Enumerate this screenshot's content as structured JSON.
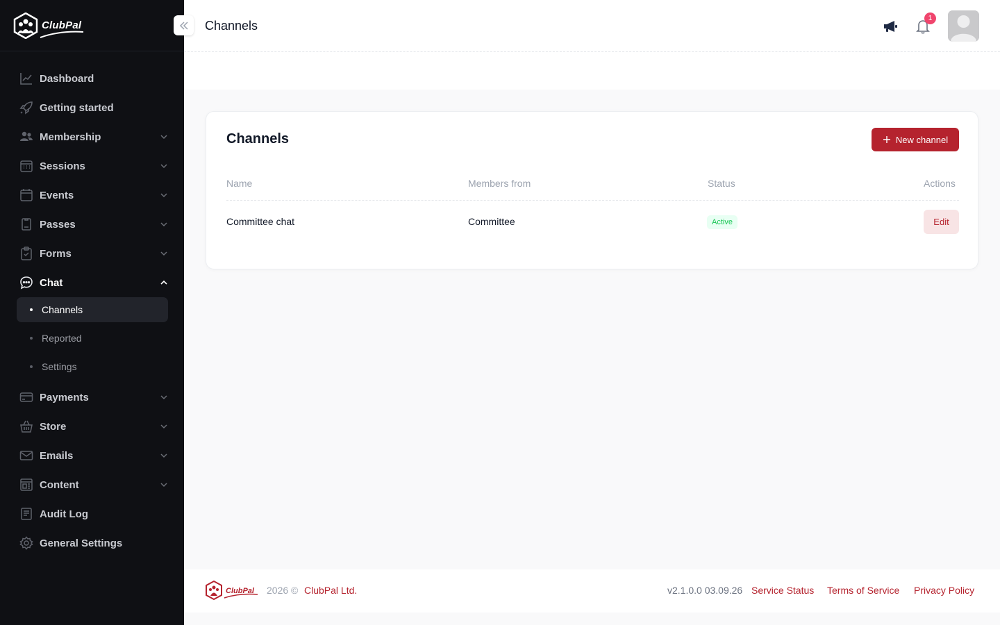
{
  "app": {
    "brand": "ClubPal",
    "accent": "#b5232e"
  },
  "header": {
    "title": "Channels",
    "notification_count": "1"
  },
  "sidebar": {
    "items": [
      {
        "label": "Dashboard",
        "icon": "chart-line-icon"
      },
      {
        "label": "Getting started",
        "icon": "rocket-icon"
      },
      {
        "label": "Membership",
        "icon": "users-icon"
      },
      {
        "label": "Sessions",
        "icon": "calendar-grid-icon"
      },
      {
        "label": "Events",
        "icon": "calendar-icon"
      },
      {
        "label": "Passes",
        "icon": "pass-icon"
      },
      {
        "label": "Forms",
        "icon": "clipboard-icon"
      },
      {
        "label": "Chat",
        "icon": "chat-icon"
      },
      {
        "label": "Payments",
        "icon": "credit-card-icon"
      },
      {
        "label": "Store",
        "icon": "basket-icon"
      },
      {
        "label": "Emails",
        "icon": "envelope-icon"
      },
      {
        "label": "Content",
        "icon": "layout-icon"
      },
      {
        "label": "Audit Log",
        "icon": "document-list-icon"
      },
      {
        "label": "General Settings",
        "icon": "gear-icon"
      }
    ],
    "chat_sub": [
      {
        "label": "Channels",
        "active": true
      },
      {
        "label": "Reported",
        "active": false
      },
      {
        "label": "Settings",
        "active": false
      }
    ]
  },
  "card": {
    "title": "Channels",
    "new_button": "New channel",
    "columns": [
      "Name",
      "Members from",
      "Status",
      "Actions"
    ],
    "rows": [
      {
        "name": "Committee chat",
        "members_from": "Committee",
        "status": "Active",
        "action": "Edit"
      }
    ]
  },
  "footer": {
    "year": "2026 ©",
    "company": "ClubPal Ltd.",
    "version": "v2.1.0.0 03.09.26",
    "links": [
      "Service Status",
      "Terms of Service",
      "Privacy Policy"
    ]
  }
}
